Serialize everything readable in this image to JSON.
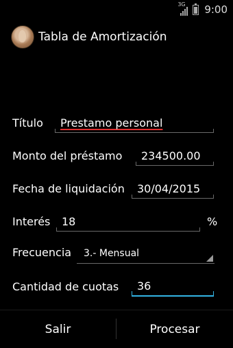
{
  "status_bar": {
    "network": "3G",
    "time": "9:00"
  },
  "app": {
    "title": "Tabla de Amortización",
    "icon": "app-logo-icon"
  },
  "form": {
    "titulo": {
      "label": "Título",
      "value": "Prestamo personal"
    },
    "monto": {
      "label": "Monto del préstamo",
      "value": "234500.00"
    },
    "fecha": {
      "label": "Fecha de liquidación",
      "value": "30/04/2015"
    },
    "interes": {
      "label": "Interés",
      "value": "18",
      "suffix": "%"
    },
    "frecuencia": {
      "label": "Frecuencia",
      "selected": "3.- Mensual"
    },
    "cuotas": {
      "label": "Cantidad de cuotas",
      "value": "36"
    }
  },
  "buttons": {
    "salir": "Salir",
    "procesar": "Procesar"
  },
  "colors": {
    "background": "#000000",
    "focus_accent": "#33b5e5",
    "spellcheck": "#e03030"
  }
}
